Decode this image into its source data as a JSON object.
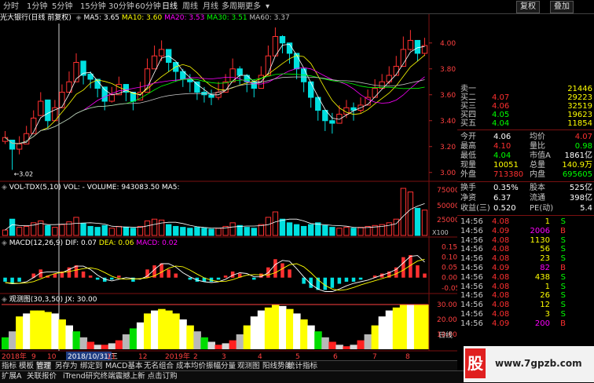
{
  "tabs": [
    "分时",
    "1分钟",
    "5分钟",
    "15分钟",
    "30分钟",
    "60分钟",
    "日线",
    "周线",
    "月线",
    "多周期",
    "更多"
  ],
  "active_tab": "日线",
  "buttons": {
    "restore": "复权",
    "overlay": "叠加"
  },
  "title": "光大银行(日线 前复权)",
  "ma": [
    {
      "label": "MA5: 3.65",
      "color": "#ffffff"
    },
    {
      "label": "MA10: 3.60",
      "color": "#ffff00"
    },
    {
      "label": "MA20: 3.53",
      "color": "#ff00ff"
    },
    {
      "label": "MA30: 3.51",
      "color": "#00ff00"
    },
    {
      "label": "MA60: 3.37",
      "color": "#c0c0c0"
    }
  ],
  "price_axis": [
    "4.00",
    "3.80",
    "3.60",
    "3.40",
    "3.20",
    "3.00"
  ],
  "low_marker": "3.02",
  "volume_title": "VOL-TDX(5,10)  VOL: -  VOLUME: 943083.50  MA5:",
  "volume_axis": [
    "75000",
    "50000",
    "25000"
  ],
  "volume_unit": "X100",
  "macd_title": "MACD(12,26,9)",
  "macd_values": [
    {
      "label": "DIF: 0.07",
      "color": "#ffffff"
    },
    {
      "label": "DEA: 0.06",
      "color": "#ffff00"
    },
    {
      "label": "MACD: 0.02",
      "color": "#ff00ff"
    }
  ],
  "macd_axis": [
    "0.15",
    "0.10",
    "0.05",
    "0.00",
    "-0.05"
  ],
  "gauge_title": "观测图(30,3,50)  JX: 30.00",
  "gauge_axis": [
    "30.00",
    "20.00",
    "10.00"
  ],
  "date_labels": [
    "2018年",
    "9",
    "10",
    "2018/10/31/三",
    "11",
    "12",
    "2019年",
    "2",
    "3",
    "4",
    "5",
    "6",
    "7",
    "8"
  ],
  "orderbook": [
    {
      "label": "卖一",
      "price": "",
      "vol": "21446"
    },
    {
      "label": "买二",
      "price": "4.07",
      "vol": "29223"
    },
    {
      "label": "买三",
      "price": "4.06",
      "vol": "32519"
    },
    {
      "label": "买四",
      "price": "4.05",
      "vol": "19623"
    },
    {
      "label": "买五",
      "price": "4.04",
      "vol": "11854"
    }
  ],
  "stats": [
    {
      "k1": "今开",
      "v1": "4.06",
      "c1": "#ffffff",
      "k2": "均价",
      "v2": "4.07",
      "c2": "#ff3030"
    },
    {
      "k1": "最高",
      "v1": "4.10",
      "c1": "#ff3030",
      "k2": "量比",
      "v2": "0.98",
      "c2": "#00ff00"
    },
    {
      "k1": "最低",
      "v1": "4.04",
      "c1": "#00ff00",
      "k2": "市值A",
      "v2": "1861亿",
      "c2": "#ffffff"
    },
    {
      "k1": "现量",
      "v1": "10051",
      "c1": "#ffff00",
      "k2": "总量",
      "v2": "140.9万",
      "c2": "#ffff00"
    },
    {
      "k1": "外盘",
      "v1": "713380",
      "c1": "#ff3030",
      "k2": "内盘",
      "v2": "695605",
      "c2": "#00ff00"
    }
  ],
  "stats2": [
    {
      "k1": "换手",
      "v1": "0.35%",
      "k2": "股本",
      "v2": "525亿"
    },
    {
      "k1": "净资",
      "v1": "6.37",
      "k2": "流通",
      "v2": "398亿"
    },
    {
      "k1": "收益(三)",
      "v1": "0.520",
      "k2": "PE(动)",
      "v2": "5.4"
    }
  ],
  "ticks": [
    {
      "time": "14:56",
      "price": "4.08",
      "vol": "1",
      "side": "S"
    },
    {
      "time": "14:56",
      "price": "4.09",
      "vol": "2006",
      "side": "B"
    },
    {
      "time": "14:56",
      "price": "4.08",
      "vol": "1130",
      "side": "S"
    },
    {
      "time": "14:56",
      "price": "4.08",
      "vol": "56",
      "side": "S"
    },
    {
      "time": "14:56",
      "price": "4.08",
      "vol": "23",
      "side": "S"
    },
    {
      "time": "14:56",
      "price": "4.09",
      "vol": "82",
      "side": "B"
    },
    {
      "time": "14:56",
      "price": "4.08",
      "vol": "438",
      "side": "S"
    },
    {
      "time": "14:56",
      "price": "4.08",
      "vol": "1",
      "side": "S"
    },
    {
      "time": "14:56",
      "price": "4.08",
      "vol": "26",
      "side": "S"
    },
    {
      "time": "14:56",
      "price": "4.08",
      "vol": "12",
      "side": "S"
    },
    {
      "time": "14:56",
      "price": "4.08",
      "vol": "3",
      "side": "S"
    },
    {
      "time": "14:56",
      "price": "4.09",
      "vol": "200",
      "side": "B"
    }
  ],
  "right_tab": "日线",
  "bottom_menu1": [
    "指标",
    "模板",
    "管理",
    "另存为",
    "绑定到",
    "MACD基本",
    "无名组合",
    "成本均价振幅分量",
    "观测图",
    "阳线势能",
    "统计指标"
  ],
  "bottom_menu2": [
    "扩展A",
    "关联报价",
    "iTrend研究终端震撼上新 点击订购"
  ],
  "watermark": "www.7gpzb.com",
  "watermark_logo": "股",
  "chart_data": {
    "type": "candlestick",
    "title": "光大银行(日线 前复权)",
    "ylim": [
      2.95,
      4.15
    ],
    "x": [
      "2018年",
      "9",
      "10",
      "2018/10/31/三",
      "11",
      "12",
      "2019年",
      "2",
      "3",
      "4",
      "5",
      "6",
      "7",
      "8"
    ],
    "close": [
      3.27,
      3.18,
      3.22,
      3.3,
      3.42,
      3.55,
      3.4,
      3.5,
      3.62,
      3.7,
      3.85,
      3.75,
      3.72,
      3.65,
      3.55,
      3.6,
      3.68,
      3.62,
      3.55,
      3.62,
      3.8,
      3.9,
      3.95,
      3.85,
      3.78,
      3.72,
      3.7,
      3.62,
      3.6,
      3.58,
      3.62,
      3.7,
      3.8,
      3.75,
      3.7,
      3.65,
      3.75,
      3.9,
      4.05,
      4.0,
      3.92,
      3.8,
      3.7,
      3.58,
      3.48,
      3.4,
      3.38,
      3.45,
      3.5,
      3.48,
      3.52,
      3.58,
      3.65,
      3.7,
      3.75,
      3.82,
      3.95,
      4.02,
      3.92,
      3.98
    ],
    "high": [
      3.32,
      3.24,
      3.28,
      3.36,
      3.48,
      3.62,
      3.5,
      3.56,
      3.68,
      3.78,
      3.92,
      3.82,
      3.78,
      3.72,
      3.62,
      3.66,
      3.74,
      3.68,
      3.62,
      3.7,
      3.88,
      3.98,
      4.02,
      3.92,
      3.85,
      3.8,
      3.76,
      3.7,
      3.66,
      3.64,
      3.7,
      3.76,
      3.88,
      3.82,
      3.76,
      3.72,
      3.82,
      3.98,
      4.12,
      4.06,
      3.98,
      3.88,
      3.76,
      3.66,
      3.55,
      3.48,
      3.46,
      3.52,
      3.56,
      3.54,
      3.58,
      3.64,
      3.72,
      3.76,
      3.82,
      3.9,
      4.05,
      4.1,
      4.0,
      4.04
    ],
    "low": [
      3.22,
      3.02,
      3.14,
      3.24,
      3.36,
      3.46,
      3.34,
      3.44,
      3.54,
      3.62,
      3.76,
      3.68,
      3.65,
      3.58,
      3.48,
      3.54,
      3.6,
      3.55,
      3.48,
      3.56,
      3.72,
      3.82,
      3.86,
      3.78,
      3.7,
      3.66,
      3.62,
      3.56,
      3.54,
      3.52,
      3.56,
      3.62,
      3.72,
      3.68,
      3.62,
      3.58,
      3.68,
      3.82,
      3.96,
      3.92,
      3.84,
      3.72,
      3.62,
      3.5,
      3.4,
      3.32,
      3.3,
      3.38,
      3.42,
      3.4,
      3.46,
      3.52,
      3.58,
      3.64,
      3.68,
      3.75,
      3.86,
      3.94,
      3.86,
      3.9
    ],
    "open": [
      3.24,
      3.25,
      3.18,
      3.22,
      3.3,
      3.44,
      3.56,
      3.4,
      3.5,
      3.62,
      3.7,
      3.86,
      3.76,
      3.72,
      3.66,
      3.55,
      3.6,
      3.68,
      3.62,
      3.56,
      3.62,
      3.8,
      3.9,
      3.95,
      3.85,
      3.78,
      3.72,
      3.7,
      3.62,
      3.6,
      3.58,
      3.62,
      3.7,
      3.8,
      3.75,
      3.7,
      3.65,
      3.75,
      3.9,
      4.05,
      4.0,
      3.92,
      3.8,
      3.7,
      3.58,
      3.48,
      3.4,
      3.38,
      3.45,
      3.5,
      3.48,
      3.52,
      3.58,
      3.65,
      3.7,
      3.75,
      3.82,
      3.95,
      4.02,
      3.92
    ],
    "volume": [
      6,
      18,
      9,
      10,
      14,
      16,
      11,
      9,
      12,
      15,
      20,
      13,
      10,
      9,
      11,
      8,
      10,
      9,
      8,
      10,
      16,
      18,
      17,
      12,
      10,
      9,
      8,
      9,
      8,
      7,
      8,
      10,
      14,
      11,
      9,
      8,
      12,
      20,
      26,
      18,
      14,
      12,
      10,
      12,
      14,
      11,
      9,
      8,
      9,
      8,
      9,
      10,
      11,
      12,
      14,
      18,
      52,
      48,
      30,
      28
    ],
    "macd_hist": [
      -0.02,
      -0.03,
      -0.02,
      0.0,
      0.02,
      0.04,
      0.01,
      0.02,
      0.03,
      0.05,
      0.06,
      0.03,
      0.01,
      -0.01,
      -0.02,
      -0.01,
      0.01,
      0.0,
      -0.02,
      0.0,
      0.04,
      0.06,
      0.07,
      0.04,
      0.02,
      0.0,
      -0.01,
      -0.02,
      -0.02,
      -0.02,
      -0.01,
      0.01,
      0.03,
      0.02,
      0.0,
      -0.01,
      0.02,
      0.05,
      0.09,
      0.07,
      0.04,
      0.0,
      -0.03,
      -0.05,
      -0.06,
      -0.06,
      -0.05,
      -0.03,
      -0.02,
      -0.02,
      -0.01,
      0.0,
      0.01,
      0.02,
      0.03,
      0.05,
      0.1,
      0.11,
      0.06,
      0.02
    ],
    "gauge_level": [
      8,
      12,
      22,
      24,
      26,
      26,
      25,
      24,
      20,
      16,
      12,
      8,
      5,
      3,
      3,
      4,
      6,
      10,
      14,
      18,
      24,
      26,
      27,
      26,
      24,
      20,
      16,
      12,
      8,
      5,
      3,
      4,
      6,
      10,
      16,
      22,
      26,
      28,
      30,
      29,
      27,
      24,
      20,
      16,
      12,
      8,
      5,
      3,
      2,
      3,
      6,
      10,
      16,
      22,
      26,
      28,
      30,
      30,
      30,
      30
    ]
  }
}
